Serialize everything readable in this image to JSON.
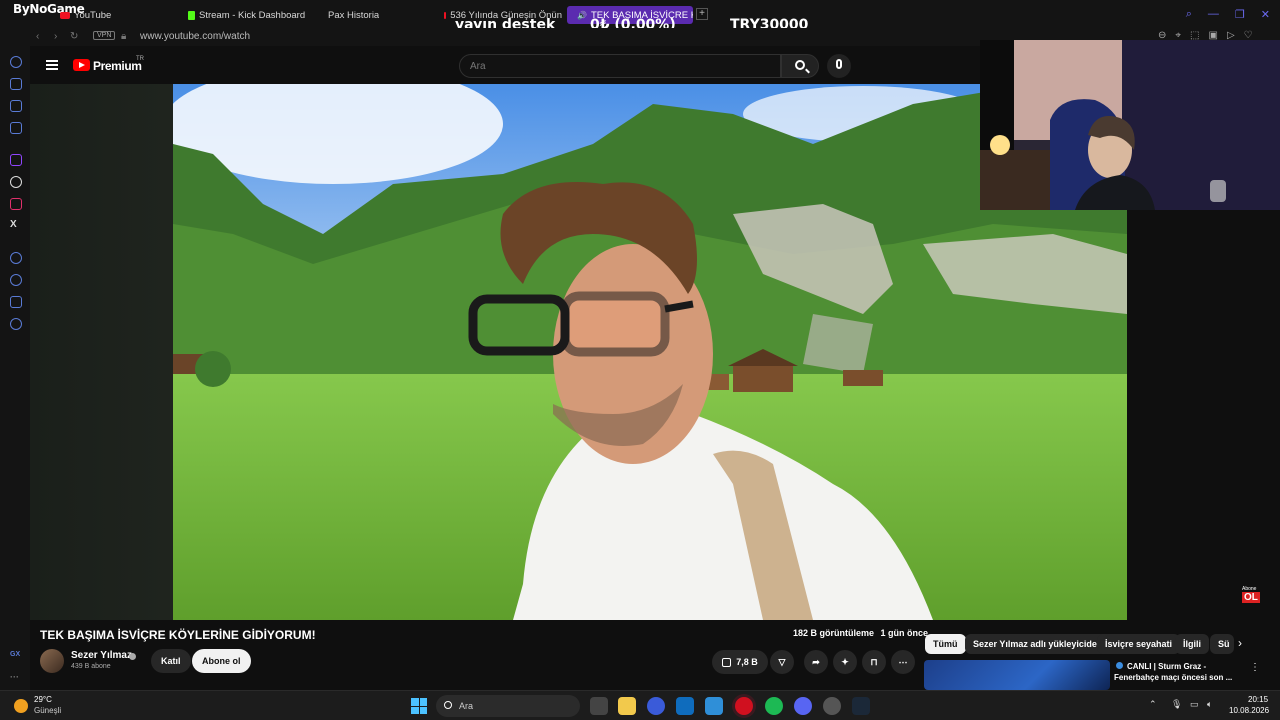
{
  "browser": {
    "brand": "ByNoGame",
    "tabs": [
      {
        "label": "YouTube"
      },
      {
        "label": "Stream - Kick Dashboard"
      },
      {
        "label": "Pax Historia"
      },
      {
        "label": "536 Yılında Güneşin Önün"
      },
      {
        "label": "TEK BAŞIMA İSVİÇRE K"
      }
    ],
    "url": "www.youtube.com/watch",
    "vpn_label": "VPN"
  },
  "overlay": {
    "donation_label": "yayın destek",
    "donation_progress": "0₺ (0.00%)",
    "donation_goal": "TRY30000"
  },
  "youtube": {
    "logo_text": "Premium",
    "region": "TR",
    "search_placeholder": "Ara"
  },
  "video": {
    "title": "TEK BAŞIMA İSVİÇRE KÖYLERİNE GİDİYORUM!",
    "views": "182 B görüntüleme",
    "uploaded": "1 gün önce",
    "channel_name": "Sezer Yılmaz",
    "subscribers": "439 B abone",
    "join_label": "Katıl",
    "subscribe_label": "Abone ol",
    "likes": "7,8 B",
    "badge_top": "Abone",
    "badge_bottom": "OL"
  },
  "chips": [
    "Tümü",
    "Sezer Yılmaz adlı yükleyiciden",
    "İsviçre seyahati",
    "İlgili",
    "Sü"
  ],
  "recommendation": {
    "title_line1": "CANLI | Sturm Graz -",
    "title_line2": "Fenerbahçe maçı öncesi son ..."
  },
  "rail": {
    "bottom_label": "GX"
  },
  "taskbar": {
    "temperature": "29°C",
    "weather": "Güneşli",
    "search_label": "Ara",
    "time": "20:15",
    "date": "10.08.2026"
  }
}
